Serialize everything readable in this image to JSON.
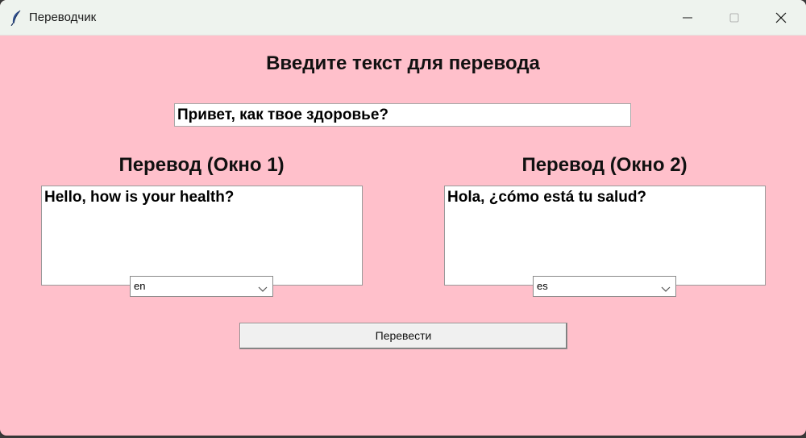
{
  "window": {
    "title": "Переводчик",
    "icon": "feather-icon"
  },
  "main": {
    "heading": "Введите текст для перевода",
    "input_value": "Привет, как твое здоровье?"
  },
  "panels": [
    {
      "label": "Перевод (Окно 1)",
      "text": "Hello, how is your health?",
      "language": "en"
    },
    {
      "label": "Перевод (Окно 2)",
      "text": "Hola, ¿cómo está tu salud?",
      "language": "es"
    }
  ],
  "actions": {
    "translate_label": "Перевести"
  },
  "colors": {
    "background": "#ffc0cb",
    "titlebar": "#eef3ee"
  }
}
